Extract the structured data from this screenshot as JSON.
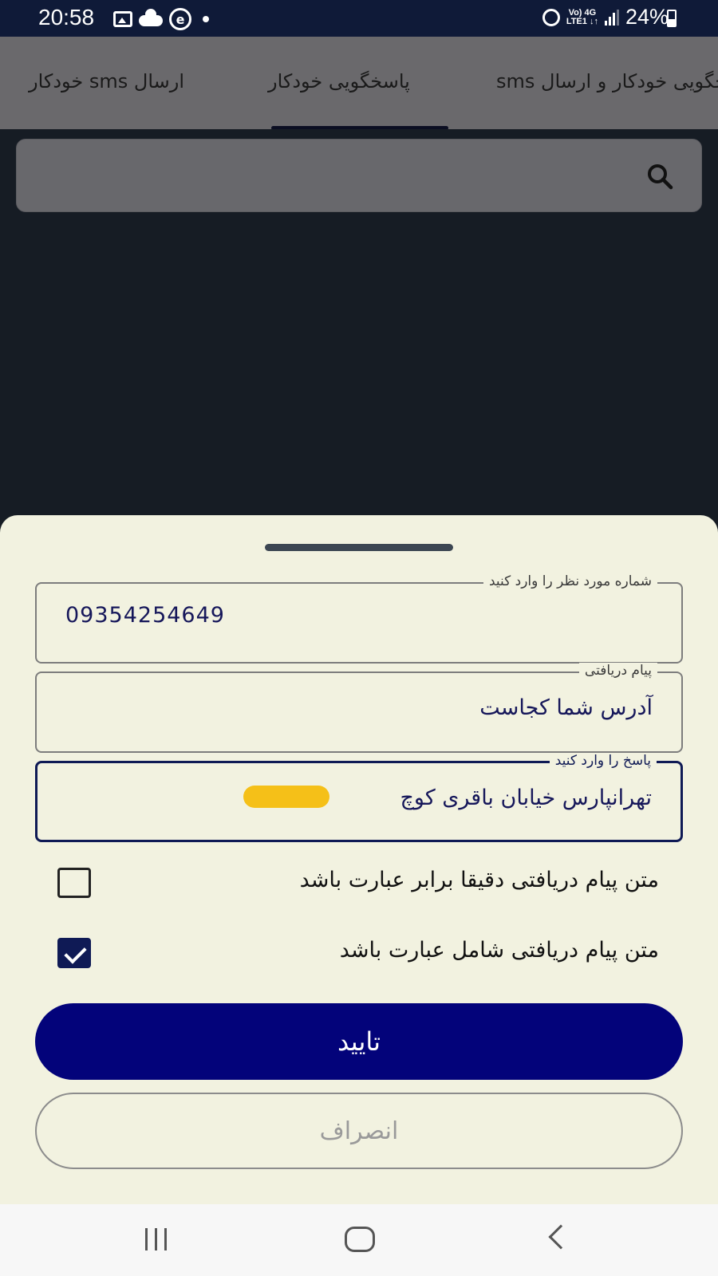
{
  "status_bar": {
    "time": "20:58",
    "battery": "24%",
    "network_top": "Vo) 4G",
    "network_bottom": "LTE1 ↓↑",
    "left_icons": [
      "image-icon",
      "cloud-icon",
      "app-e-icon",
      "notification-dot-icon"
    ],
    "right_icons": [
      "alarm-icon",
      "volte-icon",
      "signal-icon",
      "battery-icon"
    ]
  },
  "tabs": [
    {
      "label": "ارسال sms خودکار"
    },
    {
      "label": "پاسخگویی خودکار",
      "selected": true
    },
    {
      "label": "پاسخگویی خودکار و ارسال sms"
    }
  ],
  "search": {
    "icon": "search-icon"
  },
  "sheet": {
    "phone_field": {
      "label": "شماره مورد نظر را وارد کنید",
      "value": "09354254649"
    },
    "received_field": {
      "label": "پیام دریافتی",
      "value": "آدرس شما کجاست"
    },
    "reply_field": {
      "label": "پاسخ را وارد کنید",
      "value": "تهرانپارس خیابان باقری کوچ"
    },
    "options": [
      {
        "label": "متن پیام دریافتی دقیقا برابر عبارت باشد",
        "checked": false
      },
      {
        "label": "متن پیام دریافتی شامل عبارت باشد",
        "checked": true
      }
    ],
    "confirm_label": "تایید",
    "cancel_label": "انصراف"
  },
  "colors": {
    "primary": "#03037a",
    "sheet_background": "#f2f2e0",
    "redaction": "#f5c018"
  },
  "nav_bar": {
    "icons": [
      "recents-icon",
      "home-icon",
      "back-icon"
    ]
  }
}
